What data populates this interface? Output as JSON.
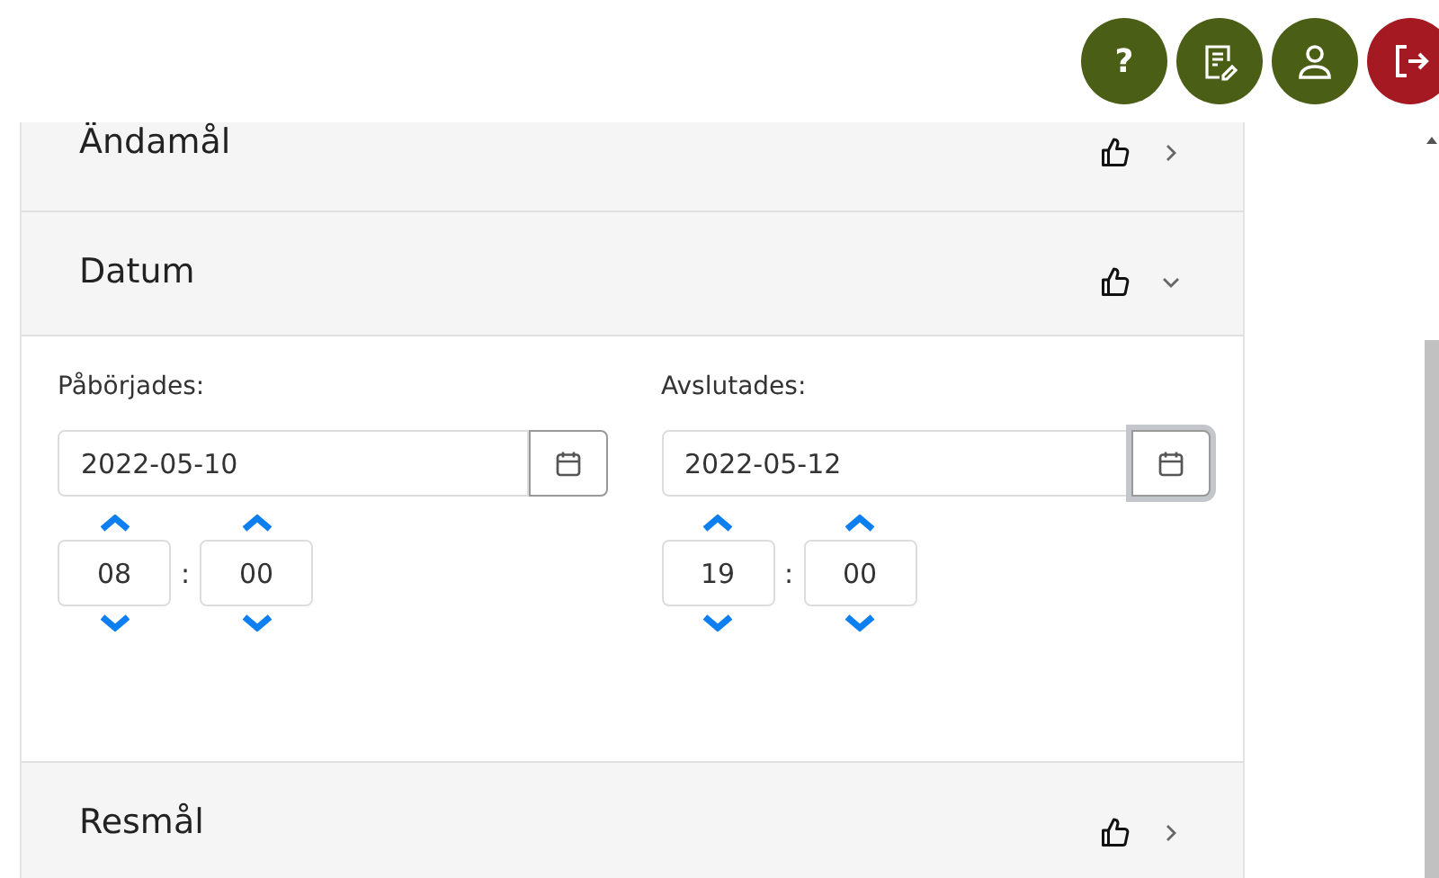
{
  "header_buttons": [
    {
      "kind": "help",
      "label": "?"
    },
    {
      "kind": "notes"
    },
    {
      "kind": "profile"
    },
    {
      "kind": "logout"
    }
  ],
  "sections": [
    {
      "title": "Ändamål",
      "expanded": false,
      "approved": true
    },
    {
      "title": "Datum",
      "expanded": true,
      "approved": true,
      "fields": [
        {
          "label": "Påbörjades:",
          "value": "2022-05-10",
          "hour": "08",
          "minute": "00",
          "separator": ":",
          "calendar_focused": false
        },
        {
          "label": "Avslutades:",
          "value": "2022-05-12",
          "hour": "19",
          "minute": "00",
          "separator": ":",
          "calendar_focused": true
        }
      ]
    },
    {
      "title": "Resmål",
      "expanded": false,
      "approved": true
    }
  ]
}
